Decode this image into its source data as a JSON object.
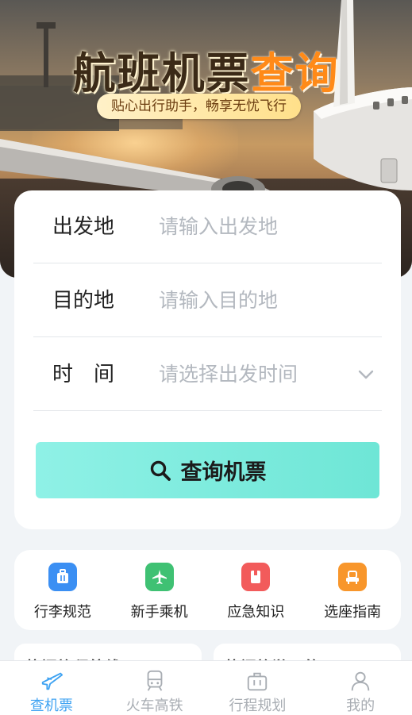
{
  "hero": {
    "title_part1": "航班机票",
    "title_part2": "查询",
    "subtitle": "贴心出行助手，畅享无忧飞行"
  },
  "form": {
    "departure": {
      "label": "出发地",
      "placeholder": "请输入出发地"
    },
    "destination": {
      "label": "目的地",
      "placeholder": "请输入目的地"
    },
    "time": {
      "label": "时　间",
      "placeholder": "请选择出发时间"
    },
    "search_button": "查询机票"
  },
  "quick_links": [
    {
      "label": "行李规范",
      "icon": "luggage-icon",
      "color": "#3b8ff3"
    },
    {
      "label": "新手乘机",
      "icon": "airplane-icon",
      "color": "#3fc173"
    },
    {
      "label": "应急知识",
      "icon": "first-aid-icon",
      "color": "#f25b5b"
    },
    {
      "label": "选座指南",
      "icon": "seat-icon",
      "color": "#f8962b"
    }
  ],
  "cards": [
    {
      "title": "热门旅程航线"
    },
    {
      "title": "热门旅游目的"
    }
  ],
  "tabs": [
    {
      "label": "查机票",
      "icon": "airplane-icon",
      "active": true
    },
    {
      "label": "火车高铁",
      "icon": "train-icon",
      "active": false
    },
    {
      "label": "行程规划",
      "icon": "briefcase-icon",
      "active": false
    },
    {
      "label": "我的",
      "icon": "user-icon",
      "active": false
    }
  ],
  "colors": {
    "accent": "#3fa3f2",
    "button": "#7cebdd",
    "title_orange": "#ff8a18"
  }
}
